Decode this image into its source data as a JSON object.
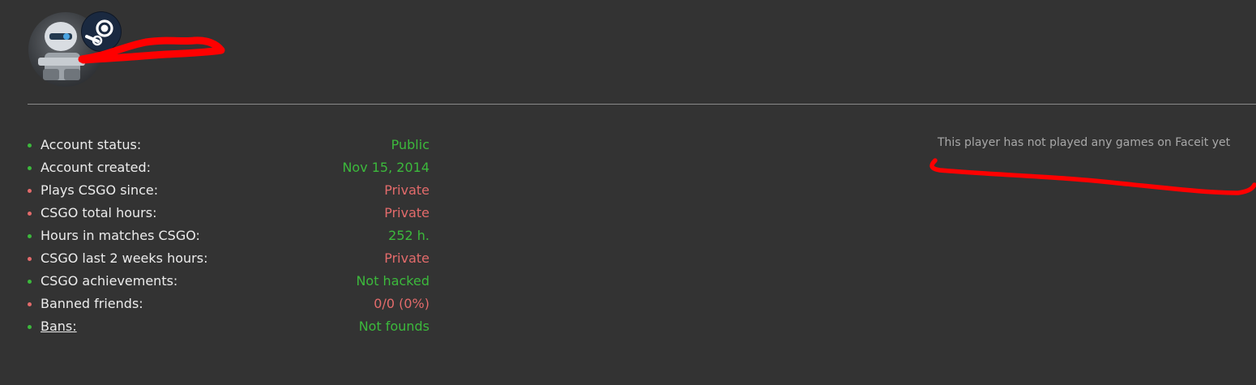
{
  "colors": {
    "background": "#333333",
    "ok": "#3cb93c",
    "bad": "#e36b6b",
    "label": "#ececec",
    "note": "#a8a8a8",
    "redaction": "#ff0000"
  },
  "header": {
    "avatar_icon": "robot-avatar",
    "badge_icon": "steam-icon"
  },
  "stats": [
    {
      "label": "Account status:",
      "value": "Public",
      "status": "ok"
    },
    {
      "label": "Account created:",
      "value": "Nov 15, 2014",
      "status": "ok"
    },
    {
      "label": "Plays CSGO since:",
      "value": "Private",
      "status": "bad"
    },
    {
      "label": "CSGO total hours:",
      "value": "Private",
      "status": "bad"
    },
    {
      "label": "Hours in matches CSGO:",
      "value": "252 h.",
      "status": "ok"
    },
    {
      "label": "CSGO last 2 weeks hours:",
      "value": "Private",
      "status": "bad"
    },
    {
      "label": "CSGO achievements:",
      "value": "Not hacked",
      "status": "ok"
    },
    {
      "label": "Banned friends:",
      "value": "0/0 (0%)",
      "status": "bad"
    },
    {
      "label": "Bans:",
      "value": "Not founds",
      "status": "ok",
      "link": true
    }
  ],
  "faceit": {
    "message": "This player has not played any games on Faceit yet"
  }
}
